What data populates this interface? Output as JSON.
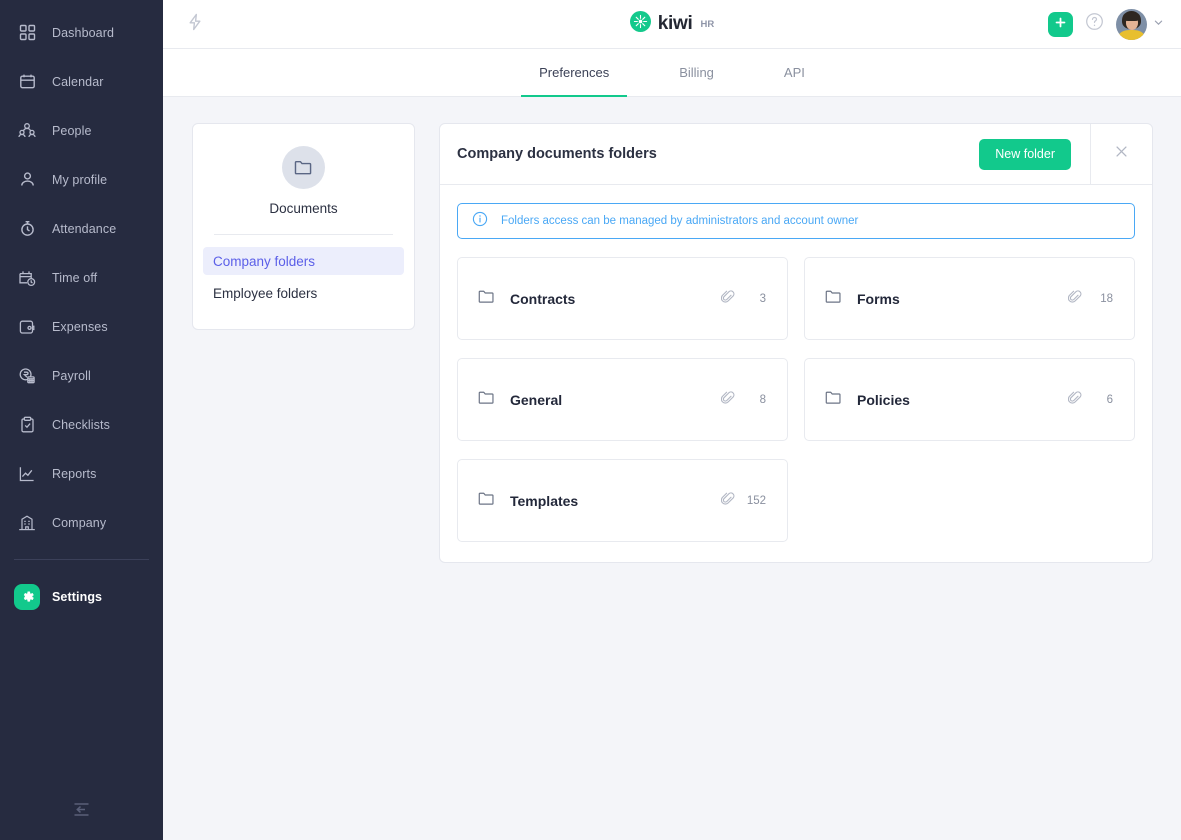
{
  "sidebar": {
    "items": [
      {
        "label": "Dashboard",
        "icon": "dashboard-grid-icon"
      },
      {
        "label": "Calendar",
        "icon": "calendar-icon"
      },
      {
        "label": "People",
        "icon": "people-icon"
      },
      {
        "label": "My profile",
        "icon": "user-icon"
      },
      {
        "label": "Attendance",
        "icon": "stopwatch-icon"
      },
      {
        "label": "Time off",
        "icon": "calendar-clock-icon"
      },
      {
        "label": "Expenses",
        "icon": "wallet-icon"
      },
      {
        "label": "Payroll",
        "icon": "payroll-icon"
      },
      {
        "label": "Checklists",
        "icon": "clipboard-check-icon"
      },
      {
        "label": "Reports",
        "icon": "chart-line-icon"
      },
      {
        "label": "Company",
        "icon": "building-icon"
      }
    ],
    "settings": {
      "label": "Settings",
      "icon": "gear-icon"
    },
    "collapse": {
      "icon": "collapse-sidebar-icon"
    },
    "accent": "#12c98c",
    "background": "#262b40"
  },
  "topbar": {
    "bolt_icon": "lightning-bolt-icon",
    "brand": {
      "name": "kiwi",
      "sup": "HR"
    },
    "add_label": "+",
    "help_label": "?",
    "chevron": "chevron-down-icon"
  },
  "tabs": [
    {
      "label": "Preferences",
      "active": true
    },
    {
      "label": "Billing",
      "active": false
    },
    {
      "label": "API",
      "active": false
    }
  ],
  "documents_card": {
    "icon": "folder-icon",
    "title": "Documents",
    "nav": [
      {
        "label": "Company folders",
        "selected": true
      },
      {
        "label": "Employee folders",
        "selected": false
      }
    ],
    "selected_color": "#5b5fe8",
    "selected_bg": "#eceefc"
  },
  "panel": {
    "title": "Company documents folders",
    "new_folder_label": "New folder",
    "close_label": "×",
    "notice": {
      "icon": "info-circle-icon",
      "text": "Folders access can be managed by administrators and account owner",
      "color": "#4aa8f5"
    },
    "folders": [
      {
        "name": "Contracts",
        "count": "3"
      },
      {
        "name": "Forms",
        "count": "18"
      },
      {
        "name": "General",
        "count": "8"
      },
      {
        "name": "Policies",
        "count": "6"
      },
      {
        "name": "Templates",
        "count": "152"
      }
    ],
    "attachment_icon": "paperclip-icon"
  }
}
